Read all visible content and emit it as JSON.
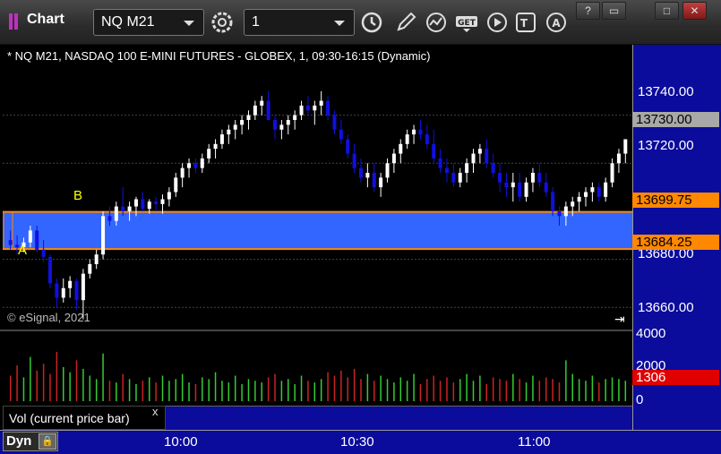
{
  "app": {
    "title": "Chart"
  },
  "toolbar": {
    "symbol": "NQ M21",
    "interval": "1",
    "icons": [
      "gear-icon",
      "clock-icon",
      "pencil-icon",
      "line-chart-icon",
      "get-icon",
      "play-icon",
      "text-icon",
      "alert-icon"
    ]
  },
  "window_buttons": [
    "?",
    "▭",
    "□",
    "✕"
  ],
  "chart": {
    "header": "* NQ M21, NASDAQ 100 E-MINI FUTURES - GLOBEX, 1, 09:30-16:15 (Dynamic)",
    "copyright": "© eSignal, 2021",
    "marker_a": "A",
    "marker_b": "B"
  },
  "price_axis": {
    "labels": [
      "13740.00",
      "13720.00",
      "13680.00",
      "13660.00"
    ],
    "last_price": "13730.00",
    "band_top": "13699.75",
    "band_bottom": "13684.25"
  },
  "volume_axis": {
    "labels": [
      "4000",
      "2000",
      "0"
    ],
    "current": "1306"
  },
  "indicator": {
    "label": "Vol (current price bar)",
    "close": "x"
  },
  "time_axis": {
    "labels": [
      "10:00",
      "10:30",
      "11:00"
    ]
  },
  "status": {
    "mode": "Dyn"
  },
  "colors": {
    "up": "#ffffff",
    "down": "#1010e0",
    "band": "#3366ff",
    "band_edge": "#ff8800",
    "vol_up": "#33cc33",
    "vol_down": "#cc2222"
  },
  "chart_data": {
    "type": "candlestick",
    "ylim": [
      13653,
      13760
    ],
    "candles": [
      [
        13688,
        13692,
        13684,
        13686
      ],
      [
        13686,
        13690,
        13682,
        13685
      ],
      [
        13685,
        13689,
        13683,
        13687
      ],
      [
        13687,
        13694,
        13685,
        13692
      ],
      [
        13692,
        13694,
        13683,
        13684
      ],
      [
        13684,
        13688,
        13679,
        13681
      ],
      [
        13681,
        13682,
        13668,
        13670
      ],
      [
        13670,
        13672,
        13660,
        13664
      ],
      [
        13664,
        13672,
        13662,
        13668
      ],
      [
        13668,
        13673,
        13664,
        13671
      ],
      [
        13671,
        13672,
        13659,
        13663
      ],
      [
        13663,
        13676,
        13655,
        13674
      ],
      [
        13674,
        13680,
        13672,
        13678
      ],
      [
        13678,
        13684,
        13676,
        13682
      ],
      [
        13682,
        13700,
        13680,
        13698
      ],
      [
        13698,
        13702,
        13694,
        13696
      ],
      [
        13696,
        13704,
        13694,
        13702
      ],
      [
        13702,
        13710,
        13698,
        13700
      ],
      [
        13700,
        13704,
        13696,
        13702
      ],
      [
        13702,
        13706,
        13698,
        13705
      ],
      [
        13705,
        13708,
        13700,
        13701
      ],
      [
        13701,
        13705,
        13699,
        13704
      ],
      [
        13704,
        13706,
        13700,
        13703
      ],
      [
        13703,
        13707,
        13699,
        13705
      ],
      [
        13705,
        13710,
        13702,
        13708
      ],
      [
        13708,
        13716,
        13706,
        13714
      ],
      [
        13714,
        13720,
        13710,
        13718
      ],
      [
        13718,
        13722,
        13714,
        13720
      ],
      [
        13720,
        13722,
        13716,
        13718
      ],
      [
        13718,
        13724,
        13716,
        13722
      ],
      [
        13722,
        13728,
        13720,
        13726
      ],
      [
        13726,
        13730,
        13722,
        13728
      ],
      [
        13728,
        13734,
        13726,
        13732
      ],
      [
        13732,
        13736,
        13728,
        13734
      ],
      [
        13734,
        13738,
        13730,
        13736
      ],
      [
        13736,
        13740,
        13732,
        13738
      ],
      [
        13738,
        13742,
        13734,
        13740
      ],
      [
        13740,
        13746,
        13738,
        13744
      ],
      [
        13744,
        13748,
        13740,
        13746
      ],
      [
        13746,
        13750,
        13742,
        13738
      ],
      [
        13738,
        13740,
        13730,
        13734
      ],
      [
        13734,
        13738,
        13730,
        13736
      ],
      [
        13736,
        13740,
        13732,
        13738
      ],
      [
        13738,
        13742,
        13734,
        13740
      ],
      [
        13740,
        13746,
        13738,
        13744
      ],
      [
        13744,
        13748,
        13740,
        13742
      ],
      [
        13742,
        13746,
        13736,
        13744
      ],
      [
        13744,
        13750,
        13740,
        13746
      ],
      [
        13746,
        13748,
        13738,
        13740
      ],
      [
        13740,
        13742,
        13732,
        13734
      ],
      [
        13734,
        13738,
        13728,
        13730
      ],
      [
        13730,
        13732,
        13722,
        13724
      ],
      [
        13724,
        13728,
        13716,
        13718
      ],
      [
        13718,
        13722,
        13712,
        13714
      ],
      [
        13714,
        13720,
        13710,
        13716
      ],
      [
        13716,
        13720,
        13708,
        13710
      ],
      [
        13710,
        13716,
        13706,
        13714
      ],
      [
        13714,
        13722,
        13712,
        13720
      ],
      [
        13720,
        13726,
        13716,
        13724
      ],
      [
        13724,
        13730,
        13720,
        13728
      ],
      [
        13728,
        13734,
        13726,
        13732
      ],
      [
        13732,
        13736,
        13728,
        13734
      ],
      [
        13734,
        13738,
        13730,
        13732
      ],
      [
        13732,
        13736,
        13726,
        13728
      ],
      [
        13728,
        13734,
        13720,
        13722
      ],
      [
        13722,
        13726,
        13716,
        13718
      ],
      [
        13718,
        13722,
        13712,
        13716
      ],
      [
        13716,
        13720,
        13710,
        13712
      ],
      [
        13712,
        13718,
        13710,
        13716
      ],
      [
        13716,
        13722,
        13712,
        13720
      ],
      [
        13720,
        13726,
        13716,
        13724
      ],
      [
        13724,
        13728,
        13720,
        13726
      ],
      [
        13726,
        13730,
        13718,
        13720
      ],
      [
        13720,
        13724,
        13714,
        13716
      ],
      [
        13716,
        13720,
        13708,
        13712
      ],
      [
        13712,
        13716,
        13706,
        13710
      ],
      [
        13710,
        13716,
        13704,
        13712
      ],
      [
        13712,
        13716,
        13704,
        13706
      ],
      [
        13706,
        13714,
        13704,
        13712
      ],
      [
        13712,
        13718,
        13708,
        13716
      ],
      [
        13716,
        13720,
        13710,
        13712
      ],
      [
        13712,
        13716,
        13706,
        13708
      ],
      [
        13708,
        13710,
        13698,
        13700
      ],
      [
        13700,
        13702,
        13694,
        13698
      ],
      [
        13698,
        13704,
        13694,
        13702
      ],
      [
        13702,
        13706,
        13698,
        13704
      ],
      [
        13704,
        13708,
        13700,
        13706
      ],
      [
        13706,
        13710,
        13702,
        13708
      ],
      [
        13708,
        13712,
        13704,
        13710
      ],
      [
        13710,
        13712,
        13704,
        13706
      ],
      [
        13706,
        13714,
        13704,
        13712
      ],
      [
        13712,
        13722,
        13710,
        13720
      ],
      [
        13720,
        13726,
        13716,
        13724
      ],
      [
        13724,
        13730,
        13720,
        13730
      ]
    ],
    "volume": [
      1500,
      2100,
      1400,
      2600,
      1800,
      2200,
      1600,
      2900,
      2000,
      1700,
      2400,
      1900,
      1500,
      1300,
      2800,
      1200,
      1100,
      1600,
      1300,
      1000,
      1200,
      1400,
      1100,
      1500,
      1200,
      1300,
      1600,
      1100,
      1000,
      1400,
      1300,
      1700,
      1200,
      1100,
      1500,
      1000,
      1300,
      1200,
      1100,
      1400,
      1600,
      1200,
      1300,
      1000,
      1500,
      1200,
      1100,
      1300,
      1700,
      1500,
      1800,
      1400,
      1900,
      1300,
      1600,
      1200,
      1500,
      1300,
      1100,
      1400,
      1200,
      1600,
      1000,
      1300,
      1500,
      1200,
      1400,
      1100,
      1300,
      1600,
      1200,
      1500,
      1000,
      1400,
      1300,
      1200,
      1600,
      1300,
      1100,
      1500,
      1200,
      1400,
      1300,
      1100,
      2400,
      1600,
      1300,
      1200,
      1500,
      1100,
      1300,
      1400,
      1306,
      1200
    ]
  }
}
